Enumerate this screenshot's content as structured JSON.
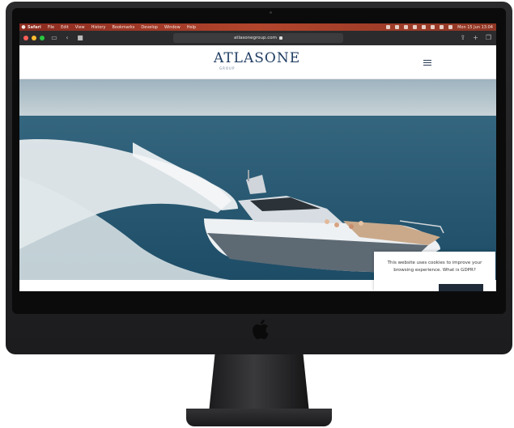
{
  "menubar": {
    "app": "Safari",
    "items": [
      "File",
      "Edit",
      "View",
      "History",
      "Bookmarks",
      "Develop",
      "Window",
      "Help"
    ],
    "clock": "Mon 15 Jun  13:04"
  },
  "toolbar": {
    "url": "atlasonegroup.com"
  },
  "site": {
    "logo": "ATLASONE",
    "logo_sub": "GROUP"
  },
  "cookie": {
    "line1": "This website uses cookies to improve your",
    "line2": "browsing experience. What is GDPR?"
  },
  "colors": {
    "menubar": "#b2452c",
    "brand": "#1f3d63",
    "toolbar": "#2b2b2d"
  }
}
